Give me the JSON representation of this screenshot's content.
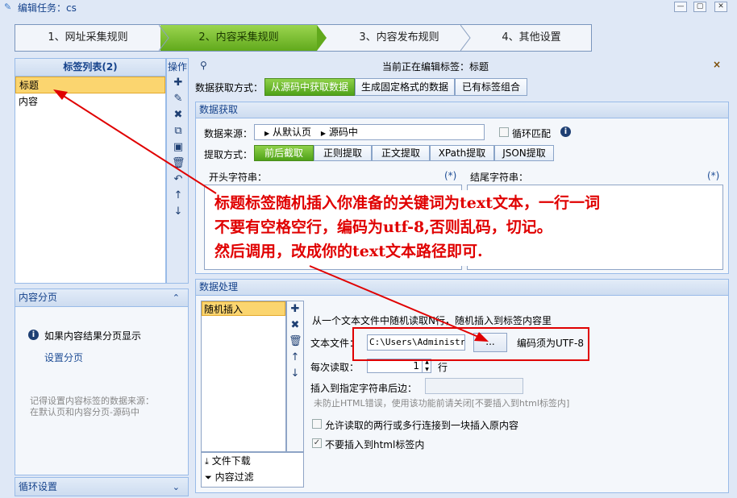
{
  "window": {
    "title": "编辑任务：cs",
    "min": "—",
    "max": "▢",
    "close": "✕"
  },
  "wizard": {
    "steps": [
      "1、网址采集规则",
      "2、内容采集规则",
      "3、内容发布规则",
      "4、其他设置"
    ]
  },
  "tag_list": {
    "header": "标签列表(2)",
    "ops_label": "操作",
    "items": [
      "标题",
      "内容"
    ]
  },
  "current_tag": {
    "text": "当前正在编辑标签：标题",
    "close": "×"
  },
  "source_mode": {
    "label": "数据获取方式：",
    "options": [
      "从源码中获取数据",
      "生成固定格式的数据",
      "已有标签组合"
    ]
  },
  "fetch": {
    "header": "数据获取",
    "source_label": "数据来源：",
    "source_path": [
      "从默认页",
      "源码中"
    ],
    "loop_label": "循环匹配",
    "method_label": "提取方式：",
    "methods": [
      "前后截取",
      "正则提取",
      "正文提取",
      "XPath提取",
      "JSON提取"
    ],
    "start_label": "开头字符串：",
    "end_label": "结尾字符串：",
    "star": "(*)"
  },
  "annotation": {
    "lines": [
      "标题标签随机插入你准备的关键词为text文本，一行一词",
      "不要有空格空行，编码为utf-8,否则乱码，切记。",
      "然后调用，改成你的text文本路径即可."
    ]
  },
  "paging": {
    "header": "内容分页",
    "info": "如果内容结果分页显示",
    "link": "设置分页",
    "hint1": "记得设置内容标签的数据来源：",
    "hint2": "在默认页和内容分页-源码中"
  },
  "loop_settings": {
    "header": "循环设置"
  },
  "processing": {
    "header": "数据处理",
    "items": [
      "随机插入"
    ],
    "bottom_items": [
      "文件下载",
      "内容过滤"
    ],
    "desc": "从一个文本文件中随机读取N行，随机插入到标签内容里",
    "file_label": "文本文件：",
    "file_value": "C:\\Users\\Administra",
    "browse": "...",
    "encoding_note": "编码须为UTF-8",
    "read_label": "每次读取：",
    "read_value": "1",
    "read_unit": "行",
    "insert_after_label": "插入到指定字符串后边：",
    "insert_after_value": "",
    "warn": "未防止HTML错误，使用该功能前请关闭[不要插入到html标签内]",
    "opt1": "允许读取的两行或多行连接到一块插入原内容",
    "opt2": "不要插入到html标签内",
    "opt1_checked": false,
    "opt2_checked": true
  },
  "colors": {
    "accent_green": "#61a91c",
    "annotation_red": "#e00000",
    "selected_row": "#fbd56f"
  }
}
